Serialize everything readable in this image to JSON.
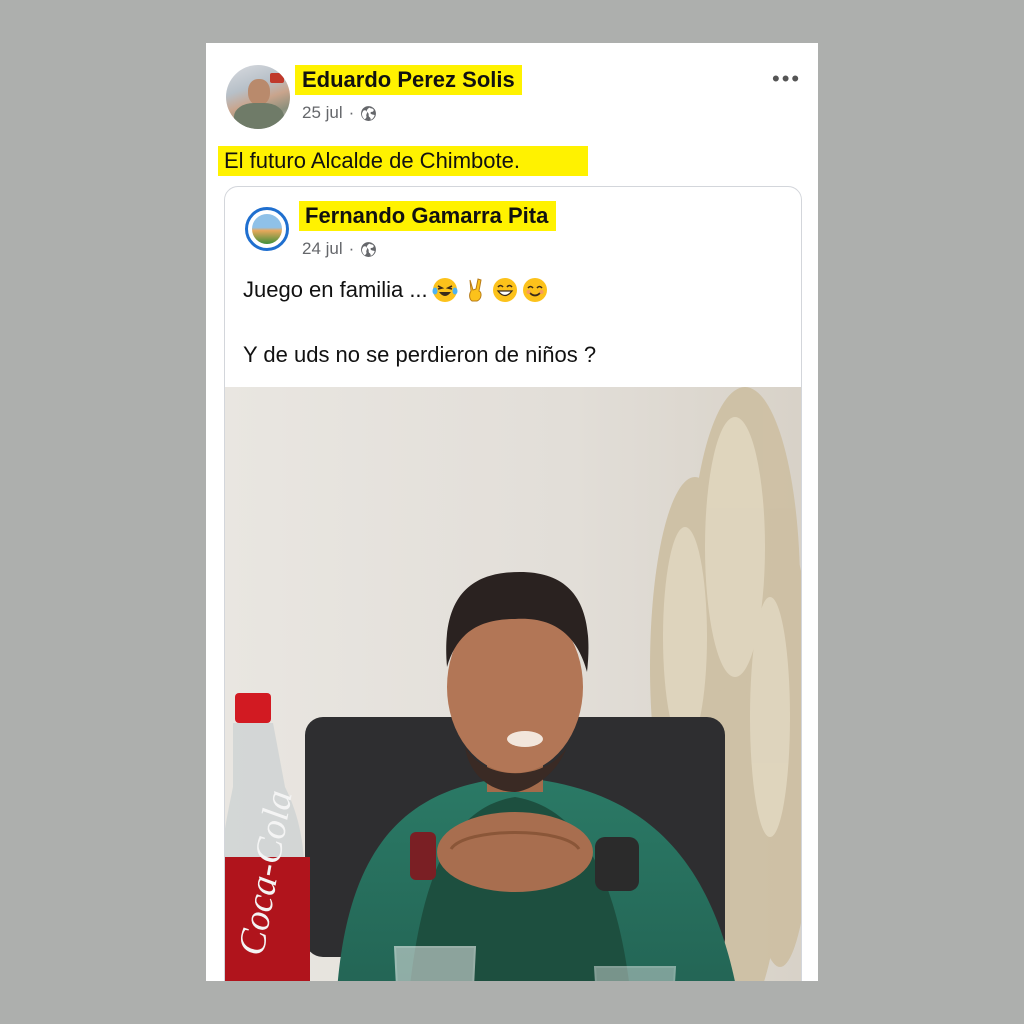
{
  "post": {
    "author": "Eduardo Perez Solis",
    "date": "25 jul",
    "separator": "·",
    "text": "El futuro Alcalde de Chimbote.",
    "more_icon": "more-options-icon",
    "privacy_icon": "globe-icon"
  },
  "shared_post": {
    "author": "Fernando Gamarra Pita",
    "date": "24 jul",
    "separator": "·",
    "text_line1": "Juego en familia ...",
    "emojis": [
      "laughing-tears-emoji",
      "victory-hand-emoji",
      "grinning-emoji",
      "smiling-emoji"
    ],
    "text_line2": "Y de uds no se perdieron de niños ?",
    "privacy_icon": "globe-icon"
  },
  "photo": {
    "bottle_label": "Coca-Cola"
  },
  "colors": {
    "highlight": "#fff200",
    "background": "#adafad",
    "meta_text": "#65676b",
    "avatar_ring": "#1f6fcf"
  }
}
